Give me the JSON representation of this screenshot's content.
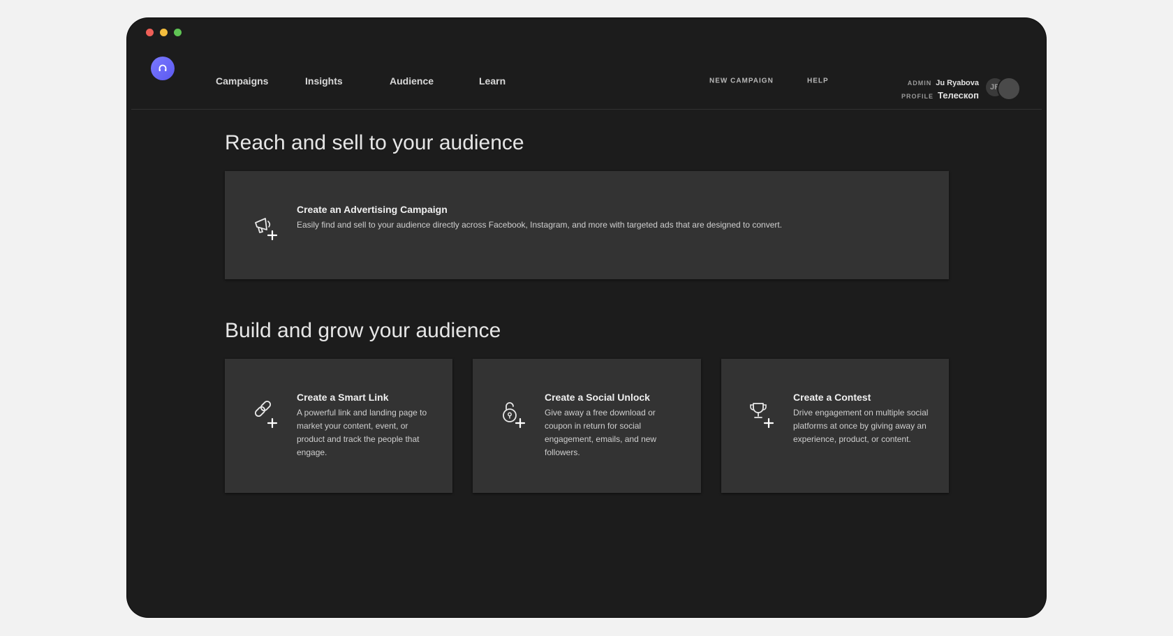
{
  "window": {
    "traffic_lights": [
      "close",
      "minimize",
      "zoom"
    ]
  },
  "nav": {
    "logo_icon": "headphones-icon",
    "links": [
      "Campaigns",
      "Insights",
      "Audience",
      "Learn"
    ],
    "new_campaign": "NEW CAMPAIGN",
    "help": "HELP"
  },
  "profile": {
    "admin_label": "ADMIN",
    "admin_name": "Ju Ryabova",
    "profile_label": "PROFILE",
    "profile_name": "Телескоп",
    "avatar_initials": "JR"
  },
  "sections": {
    "reach": {
      "title": "Reach and sell to your audience",
      "card": {
        "icon": "megaphone-plus-icon",
        "title": "Create an Advertising Campaign",
        "description": "Easily find and sell to your audience directly across Facebook, Instagram, and more with targeted ads that are designed to convert."
      }
    },
    "build": {
      "title": "Build and grow your audience",
      "cards": [
        {
          "icon": "link-plus-icon",
          "title": "Create a Smart Link",
          "description": "A powerful link and landing page to market your content, event, or product and track the people that engage."
        },
        {
          "icon": "unlock-plus-icon",
          "title": "Create a Social Unlock",
          "description": "Give away a free download or coupon in return for social engagement, emails, and new followers."
        },
        {
          "icon": "trophy-plus-icon",
          "title": "Create a Contest",
          "description": "Drive engagement on multiple social platforms at once by giving away an experience, product, or content."
        }
      ]
    }
  },
  "colors": {
    "page_bg": "#f2f2f2",
    "app_bg": "#1c1c1c",
    "card_bg": "#333333",
    "accent": "#6b69ff"
  }
}
